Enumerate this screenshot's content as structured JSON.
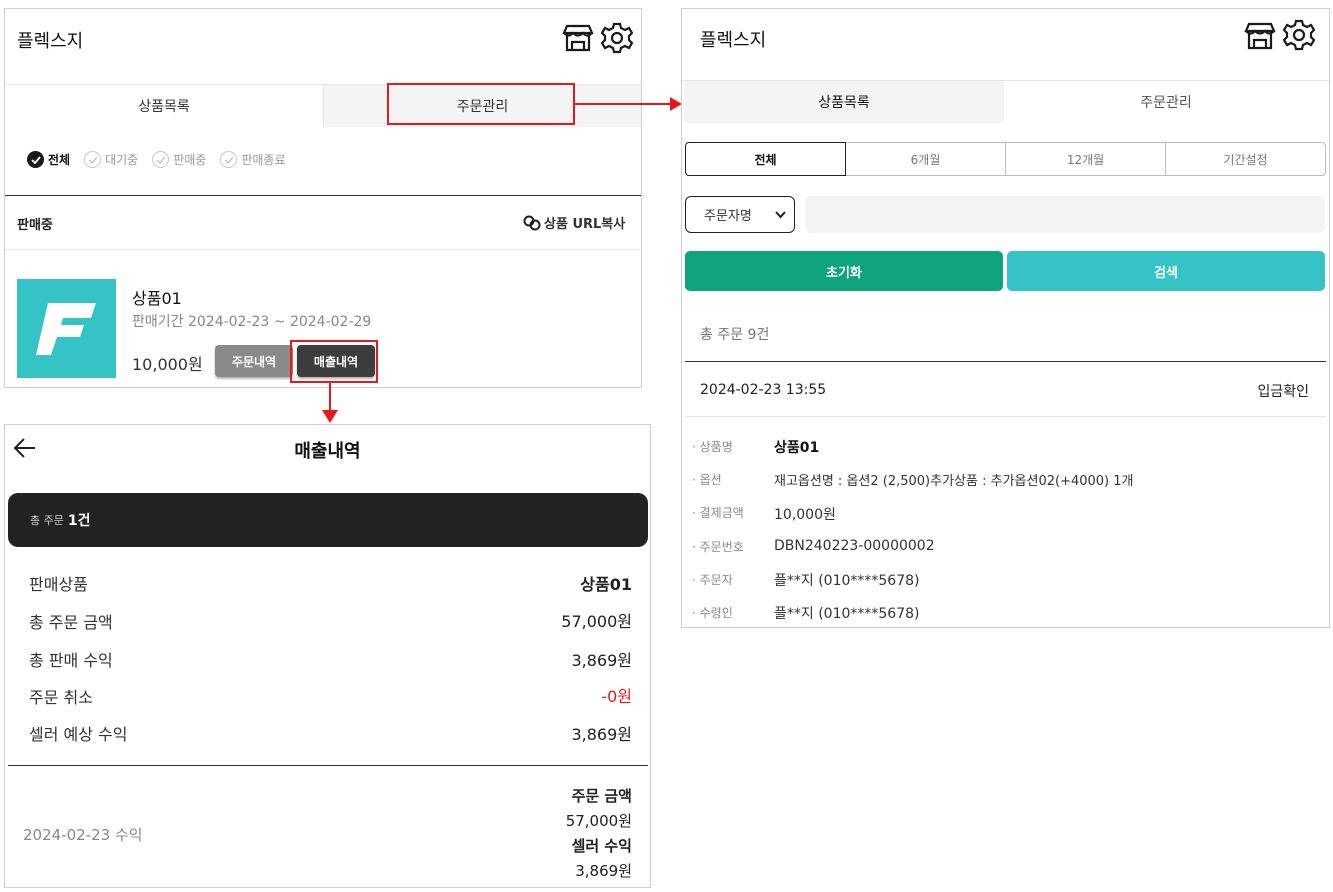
{
  "panel_list": {
    "app_title": "플렉스지",
    "icons": [
      "store-icon",
      "gear-icon"
    ],
    "tabs": [
      {
        "label": "상품목록",
        "active": true
      },
      {
        "label": "주문관리",
        "active": false
      }
    ],
    "filters": [
      {
        "label": "전체",
        "active": true
      },
      {
        "label": "대기중",
        "active": false
      },
      {
        "label": "판매중",
        "active": false
      },
      {
        "label": "판매종료",
        "active": false
      }
    ],
    "section_title": "판매중",
    "copy_url_label": "상품 URL복사",
    "product": {
      "name": "상품01",
      "period": "판매기간 2024-02-23 ~ 2024-02-29",
      "price": "10,000원",
      "order_history_label": "주문내역",
      "sales_history_label": "매출내역",
      "thumb_color": "#35c3c6"
    }
  },
  "panel_orders": {
    "app_title": "플렉스지",
    "tabs": [
      {
        "label": "상품목록",
        "active": true
      },
      {
        "label": "주문관리",
        "active": false
      }
    ],
    "period_segments": [
      "전체",
      "6개월",
      "12개월",
      "기간설정"
    ],
    "search_select": "주문자명",
    "search_input_value": "",
    "reset_label": "초기화",
    "search_label": "검색",
    "total_orders": "총 주문 9건",
    "order": {
      "datetime": "2024-02-23 13:55",
      "status": "입금확인",
      "fields": [
        {
          "label": "· 상품명",
          "value": "상품01",
          "bold": true
        },
        {
          "label": "· 옵션",
          "value": "재고옵션명 : 옵션2 (2,500)추가상품 : 추가옵션02(+4000) 1개"
        },
        {
          "label": "· 결제금액",
          "value": "10,000원"
        },
        {
          "label": "· 주문번호",
          "value": "DBN240223-00000002"
        },
        {
          "label": "· 주문자",
          "value": "플**지 (010****5678)"
        },
        {
          "label": "· 수령인",
          "value": "플**지 (010****5678)"
        }
      ]
    },
    "colors": {
      "reset": "#0fa37f",
      "search": "#35c3c6"
    }
  },
  "panel_sales": {
    "title": "매출내역",
    "summary_prefix": "총 주문",
    "summary_count": "1건",
    "rows": [
      {
        "label": "판매상품",
        "value": "상품01"
      },
      {
        "label": "총 주문 금액",
        "value": "57,000원"
      },
      {
        "label": "총 판매 수익",
        "value": "3,869원"
      },
      {
        "label": "주문 취소",
        "value": "-0원",
        "negative": true
      },
      {
        "label": "셀러 예상 수익",
        "value": "3,869원"
      }
    ],
    "daily": {
      "date_label": "2024-02-23 수익",
      "order_amount_label": "주문 금액",
      "order_amount": "57,000원",
      "seller_income_label": "셀러 수익",
      "seller_income": "3,869원"
    }
  }
}
